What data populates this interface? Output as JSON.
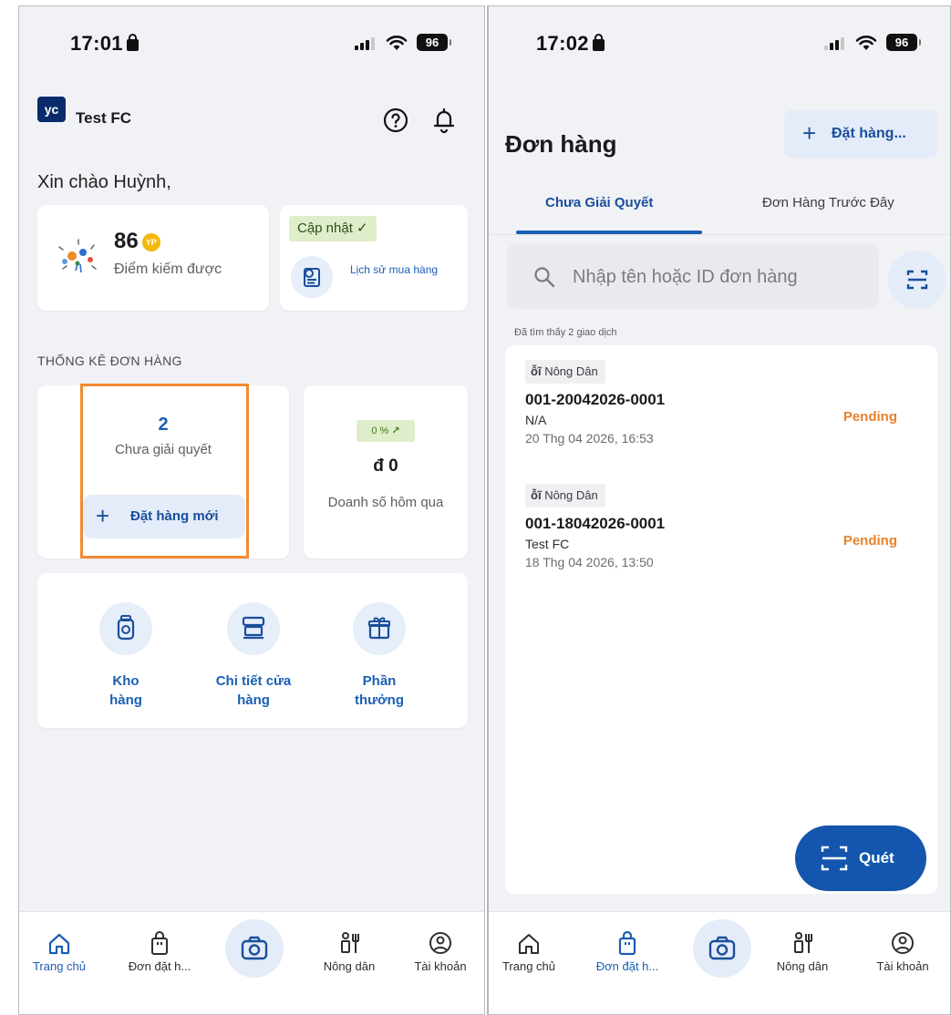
{
  "left": {
    "status": {
      "time": "17:01",
      "battery": "96"
    },
    "header": {
      "logo": "yc",
      "brand": "Test FC"
    },
    "greeting": "Xin chào Huỳnh,",
    "points": {
      "value": "86",
      "coin": "YP",
      "label": "Điểm kiếm được"
    },
    "update": {
      "badge": "Cập nhật ✓",
      "history_label": "Lịch sử mua hàng"
    },
    "section_title": "THỐNG KÊ ĐƠN HÀNG",
    "stats": {
      "pending_count": "2",
      "pending_label": "Chưa giải quyết",
      "new_order_label": "Đặt hàng mới",
      "growth": "0 %",
      "revenue": "đ 0",
      "revenue_label": "Doanh số hôm qua"
    },
    "quick_links": [
      {
        "label": "Kho hàng",
        "icon": "warehouse-icon"
      },
      {
        "label": "Chi tiết cửa hàng",
        "icon": "store-icon"
      },
      {
        "label": "Phần thưởng",
        "icon": "gift-icon"
      }
    ],
    "nav": [
      {
        "label": "Trang chủ",
        "icon": "home-icon",
        "active": true
      },
      {
        "label": "Đơn đặt h...",
        "icon": "bag-icon",
        "active": false
      },
      {
        "label": "Nông dân",
        "icon": "farmer-icon",
        "active": false
      },
      {
        "label": "Tài khoản",
        "icon": "account-icon",
        "active": false
      }
    ]
  },
  "right": {
    "status": {
      "time": "17:02",
      "battery": "96"
    },
    "title": "Đơn hàng",
    "order_button": "Đặt hàng...",
    "tabs": [
      {
        "label": "Chưa Giải Quyết",
        "active": true
      },
      {
        "label": "Đơn Hàng Trước Đây",
        "active": false
      }
    ],
    "search_placeholder": "Nhập tên hoặc ID đơn hàng",
    "found_text": "Đã tìm thấy 2 giao dịch",
    "orders": [
      {
        "type": "Nông Dân",
        "id": "001-20042026-0001",
        "customer": "N/A",
        "date": "20 Thg 04 2026, 16:53",
        "status": "Pending"
      },
      {
        "type": "Nông Dân",
        "id": "001-18042026-0001",
        "customer": "Test FC",
        "date": "18 Thg 04 2026, 13:50",
        "status": "Pending"
      }
    ],
    "scan_button": "Quét",
    "nav": [
      {
        "label": "Trang chủ",
        "icon": "home-icon",
        "active": false
      },
      {
        "label": "Đơn đặt h...",
        "icon": "bag-icon",
        "active": true
      },
      {
        "label": "Nông dân",
        "icon": "farmer-icon",
        "active": false
      },
      {
        "label": "Tài khoản",
        "icon": "account-icon",
        "active": false
      }
    ]
  },
  "colors": {
    "primary": "#1a5fb4",
    "pending": "#e8822a",
    "highlight": "#f28a33",
    "fab": "#1456ad",
    "badge_green": "#dfeeca"
  }
}
